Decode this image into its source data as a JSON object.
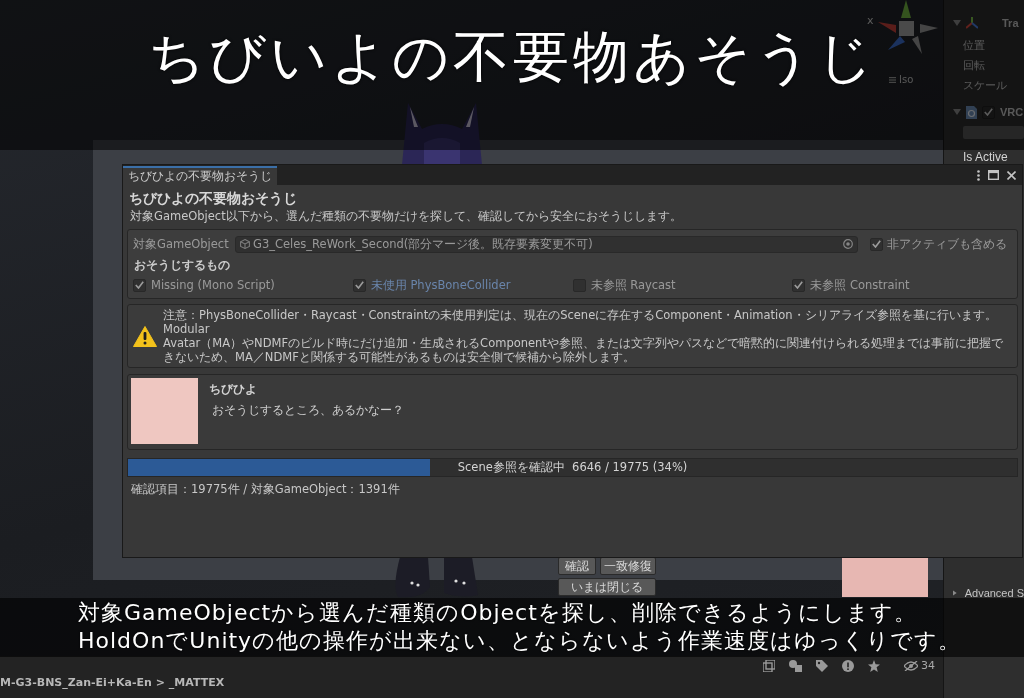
{
  "scene": {
    "axis_label": "x",
    "projection": "Iso"
  },
  "title": "ちびいよの不要物あそうじ",
  "inspector": {
    "sections": [
      {
        "kind": "component",
        "title": "Tra",
        "expanded": true,
        "rows": [
          "位置",
          "回転",
          "スケール"
        ]
      },
      {
        "kind": "script",
        "title": "VRC",
        "expanded": true,
        "enabled": true,
        "rows": [
          "Is Active"
        ]
      },
      {
        "kind": "foldout",
        "title": "Advanced S",
        "expanded": false
      }
    ]
  },
  "background_window": {
    "buttons": [
      "確認",
      "一致修復",
      "いまは閉じる"
    ]
  },
  "dialog": {
    "tab": "ちびひよの不要物おそうじ",
    "heading": "ちびひよの不要物おそうじ",
    "description": "対象GameObject以下から、選んだ種類の不要物だけを探して、確認してから安全におそうじします。",
    "settings": {
      "disabled": true,
      "target_label": "対象GameObject",
      "target_value": "G3_Celes_ReWork_Second(部分マージ後。既存要素変更不可)",
      "include_inactive": {
        "label": "非アクティブも含める",
        "checked": true
      },
      "section_label": "おそうじするもの",
      "categories": [
        {
          "label": "Missing (Mono Script)",
          "checked": true,
          "focused": false
        },
        {
          "label": "未使用 PhysBoneCollider",
          "checked": true,
          "focused": true
        },
        {
          "label": "未参照 Raycast",
          "checked": false,
          "focused": false
        },
        {
          "label": "未参照 Constraint",
          "checked": true,
          "focused": false
        }
      ]
    },
    "notice": {
      "kind": "warning",
      "text": "注意：PhysBoneCollider・Raycast・Constraintの未使用判定は、現在のSceneに存在するComponent・Animation・シリアライズ参照を基に行います。\nModular\nAvatar（MA）やNDMFのビルド時にだけ追加・生成されるComponentや参照、または文字列やパスなどで暗黙的に関連付けられる処理までは事前に把握できないため、MA／NDMFと関係する可能性があるものは安全側で候補から除外します。"
    },
    "message": {
      "speaker": "ちびひよ",
      "text": "おそうじするところ、あるかなー？"
    },
    "progress": {
      "label": "Scene参照を確認中  6646 / 19775 (34%)",
      "level": 0.34
    },
    "summary": "確認項目：19775件 / 対象GameObject：1391件"
  },
  "caption": [
    "対象GameObjectから選んだ種類のObjectを探し、削除できるようにします。",
    "HoldOnでUnityの他の操作が出来ない、とならないよう作業速度はゆっくりです。"
  ],
  "project": {
    "path": "M-G3-BNS_Zan-Ei+Ka-En > _MATTEX",
    "hidden_count": "34"
  }
}
